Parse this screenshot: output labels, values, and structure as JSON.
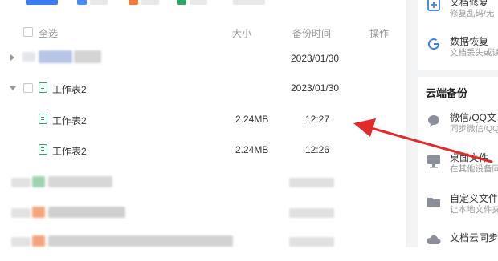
{
  "header": {
    "select_all": "全选",
    "col_size": "大小",
    "col_backup_time": "备份时间",
    "col_action": "操作"
  },
  "rows": [
    {
      "name": "",
      "size": "",
      "time": "2023/01/30"
    },
    {
      "name": "工作表2",
      "size": "",
      "time": "2023/01/30"
    },
    {
      "name": "工作表2",
      "size": "2.24MB",
      "time": "12:27"
    },
    {
      "name": "工作表2",
      "size": "2.24MB",
      "time": "12:26"
    }
  ],
  "right_panel": {
    "top_items": [
      {
        "title": "文档修复",
        "subtitle": "修复乱码/无"
      },
      {
        "title": "数据恢复",
        "subtitle": "文档丢失或误"
      }
    ],
    "cloud_section_title": "云端备份",
    "cloud_items": [
      {
        "title": "微信/QQ文",
        "subtitle": "同步微信/QQ"
      },
      {
        "title": "桌面文件",
        "subtitle": "在其他设备同"
      },
      {
        "title": "自定义文件夹",
        "subtitle": "让本地文件夹"
      },
      {
        "title": "文档云同步",
        "subtitle": ""
      }
    ]
  },
  "colors": {
    "accent_blue": "#3b7cf4",
    "sheet_green": "#2fa66a",
    "arrow_red": "#e12a2a"
  }
}
